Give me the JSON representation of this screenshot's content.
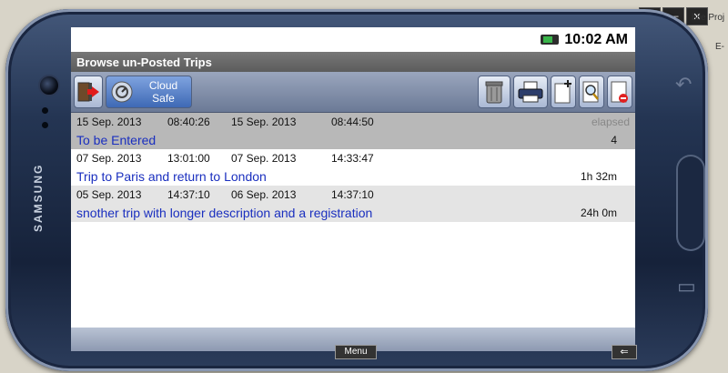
{
  "window_controls": [
    "↰",
    "—",
    "✕"
  ],
  "desktop": {
    "text_right_top": "bile Proj",
    "text_right_2": "E-"
  },
  "status": {
    "time": "10:02 AM"
  },
  "title": "Browse un-Posted Trips",
  "toolbar": {
    "cloud_line1": "Cloud",
    "cloud_line2": "Safe"
  },
  "trips": [
    {
      "start_date": "15 Sep. 2013",
      "start_time": "08:40:26",
      "end_date": "15 Sep. 2013",
      "end_time": "08:44:50",
      "right_top": "elapsed",
      "description": "To be Entered",
      "duration": "4"
    },
    {
      "start_date": "07 Sep. 2013",
      "start_time": "13:01:00",
      "end_date": "07 Sep. 2013",
      "end_time": "14:33:47",
      "right_top": "",
      "description": "Trip to Paris and return to London",
      "duration": "1h 32m"
    },
    {
      "start_date": "05 Sep. 2013",
      "start_time": "14:37:10",
      "end_date": "06 Sep. 2013",
      "end_time": "14:37:10",
      "right_top": "",
      "description": "snother trip with  longer description and a registration",
      "duration": "24h 0m"
    }
  ],
  "phone": {
    "brand": "SAMSUNG",
    "menu_label": "Menu",
    "back_label": "⇐"
  },
  "icons": [
    "exit-icon",
    "cloud-safe-icon",
    "trash-icon",
    "printer-icon",
    "new-document-icon",
    "search-document-icon",
    "delete-document-icon",
    "battery-icon"
  ]
}
